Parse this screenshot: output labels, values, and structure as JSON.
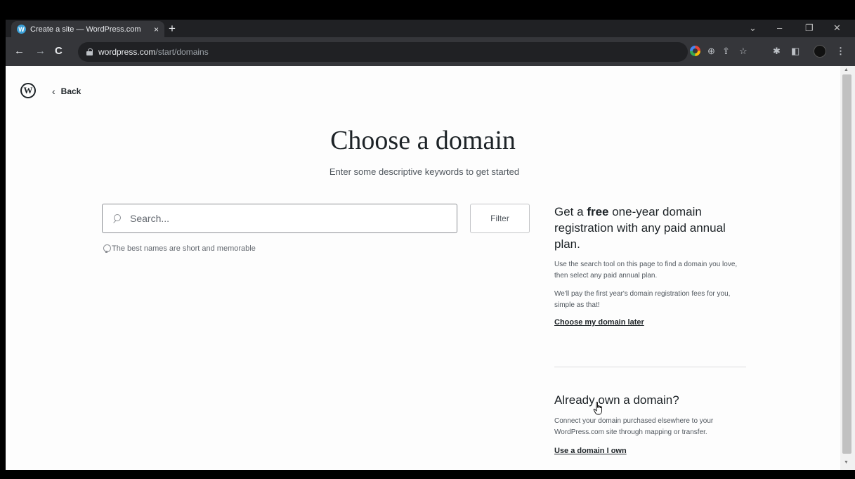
{
  "browser": {
    "tab_title": "Create a site — WordPress.com",
    "tab_favicon": "W",
    "tab_close": "×",
    "new_tab": "+",
    "window_controls": {
      "dropdown": "⌄",
      "minimize": "–",
      "restore": "❐",
      "close": "✕"
    },
    "nav": {
      "back": "←",
      "forward": "→",
      "reload": "C"
    },
    "url_host": "wordpress.com",
    "url_path": "/start/domains",
    "extensions": [
      "⊕",
      "⇪",
      "☆",
      "✱",
      "◧"
    ],
    "profile_text": "◉"
  },
  "page": {
    "back_label": "Back",
    "back_chevron": "‹",
    "logo": "W",
    "title": "Choose a domain",
    "subtitle": "Enter some descriptive keywords to get started",
    "search": {
      "placeholder": "Search...",
      "value": ""
    },
    "filter_label": "Filter",
    "hint": "The best names are short and memorable",
    "promo": {
      "heading_pre": "Get a ",
      "heading_bold": "free",
      "heading_post": " one-year domain registration with any paid annual plan.",
      "para1": "Use the search tool on this page to find a domain you love, then select any paid annual plan.",
      "para2": "We'll pay the first year's domain registration fees for you, simple as that!",
      "link": "Choose my domain later"
    },
    "own": {
      "heading": "Already own a domain?",
      "para": "Connect your domain purchased elsewhere to your WordPress.com site through mapping or transfer.",
      "link": "Use a domain I own"
    }
  },
  "colors": {
    "chrome_dark": "#202124",
    "chrome_mid": "#35363a",
    "page_bg": "#fdfdfd",
    "text_primary": "#1d2327",
    "text_secondary": "#50575e"
  }
}
